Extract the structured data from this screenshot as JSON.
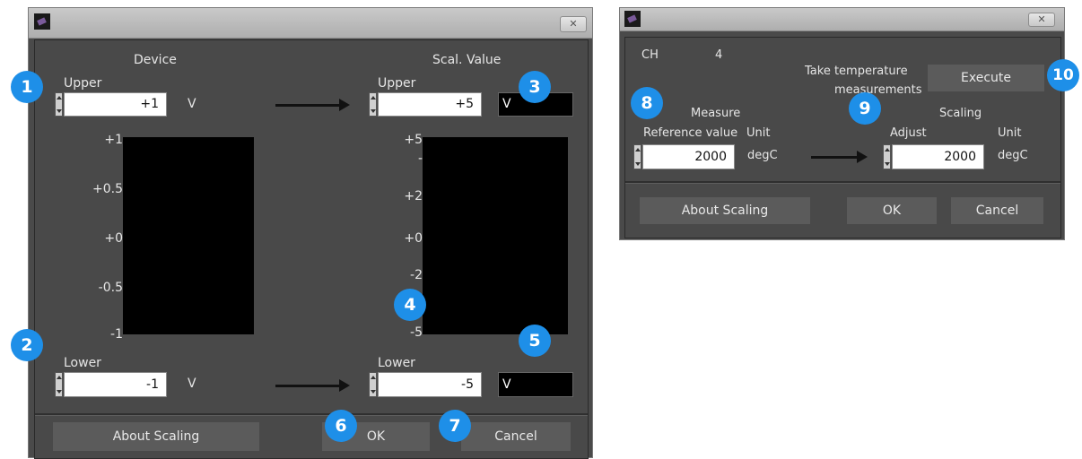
{
  "dialog1": {
    "close_glyph": "✕",
    "device_header": "Device",
    "scal_header": "Scal. Value",
    "device_upper_label": "Upper",
    "device_upper_value": "+1",
    "device_upper_unit": "V",
    "scal_upper_label": "Upper",
    "scal_upper_value": "+5",
    "scal_upper_unit": "V",
    "device_ticks": [
      "+1",
      "+0.5",
      "+0",
      "-0.5",
      "-1"
    ],
    "scal_ticks": [
      "+5",
      "+2",
      "+0",
      "-2",
      "-5"
    ],
    "device_lower_label": "Lower",
    "device_lower_value": "-1",
    "device_lower_unit": "V",
    "scal_lower_label": "Lower",
    "scal_lower_value": "-5",
    "scal_lower_unit": "V",
    "about_button": "About Scaling",
    "ok_button": "OK",
    "cancel_button": "Cancel"
  },
  "dialog2": {
    "close_glyph": "✕",
    "ch_label": "CH",
    "ch_value": "4",
    "take_temp_line1": "Take temperature",
    "take_temp_line2": "measurements",
    "execute_button": "Execute",
    "measure_header": "Measure",
    "scaling_header": "Scaling",
    "ref_value_label": "Reference value",
    "unit_label_left": "Unit",
    "adjust_label": "Adjust",
    "unit_label_right": "Unit",
    "ref_value": "2000",
    "ref_unit": "degC",
    "adjust_value": "2000",
    "adjust_unit": "degC",
    "about_button": "About Scaling",
    "ok_button": "OK",
    "cancel_button": "Cancel"
  },
  "badges": [
    "1",
    "2",
    "3",
    "4",
    "5",
    "6",
    "7",
    "8",
    "9",
    "10"
  ],
  "colors": {
    "badge": "#1e8fe8",
    "dialog_bg": "#4a4a4a",
    "button_bg": "#5b5b5b"
  }
}
